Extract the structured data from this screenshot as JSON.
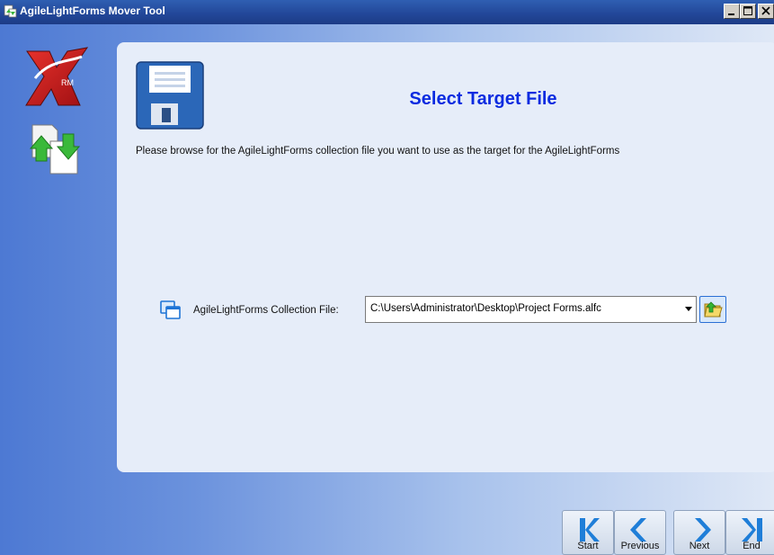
{
  "window": {
    "title": "AgileLightForms Mover Tool",
    "minimize_icon": "minimize-icon",
    "maximize_icon": "maximize-icon",
    "close_icon": "close-icon"
  },
  "sidebar": {
    "logo_icon": "crm-logo-icon",
    "logo_text": "RM",
    "move_icon": "move-forms-icon"
  },
  "panel": {
    "header_icon": "floppy-disk-icon",
    "title": "Select Target File",
    "description": "Please browse for the AgileLightForms collection file you want to use as the target for the AgileLightForms",
    "field": {
      "icon": "collection-icon",
      "label": "AgileLightForms Collection File:",
      "value": "C:\\Users\\Administrator\\Desktop\\Project Forms.alfc",
      "browse_icon": "folder-browse-icon"
    }
  },
  "navigation": {
    "start": "Start",
    "previous": "Previous",
    "next": "Next",
    "end": "End"
  },
  "colors": {
    "title_text": "#0b2be0",
    "titlebar": "#23489a",
    "panel_bg": "#e6edf9"
  }
}
